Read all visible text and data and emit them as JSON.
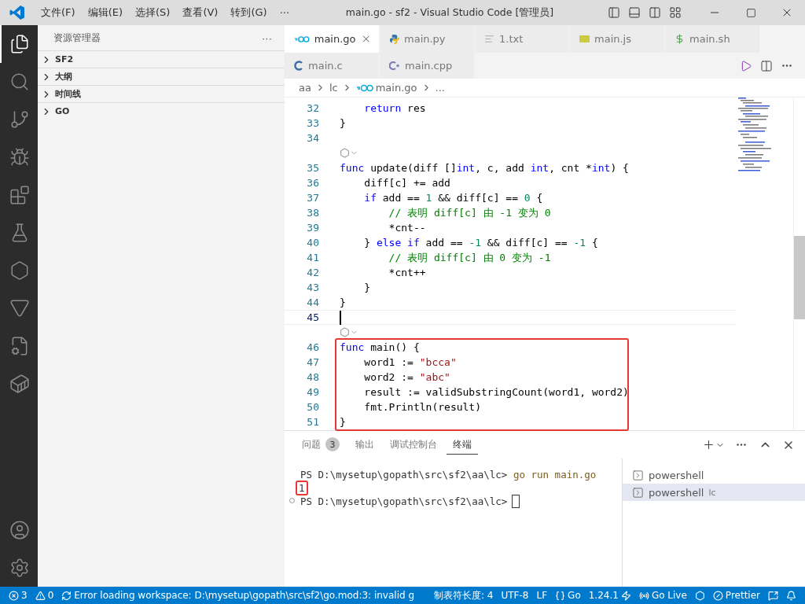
{
  "title_bar": {
    "menus": [
      "文件(F)",
      "编辑(E)",
      "选择(S)",
      "查看(V)",
      "转到(G)",
      "···"
    ],
    "title": "main.go - sf2 - Visual Studio Code [管理员]"
  },
  "activity_bar": {
    "items": [
      {
        "kind": "explorer",
        "selected": true
      },
      {
        "kind": "search",
        "selected": false
      },
      {
        "kind": "scm",
        "selected": false
      },
      {
        "kind": "debug",
        "selected": false
      },
      {
        "kind": "extensions",
        "selected": false
      },
      {
        "kind": "testing",
        "selected": false
      },
      {
        "kind": "codegeex",
        "selected": false
      },
      {
        "kind": "funnel",
        "selected": false
      },
      {
        "kind": "filecog",
        "selected": false
      },
      {
        "kind": "docker",
        "selected": false
      }
    ],
    "bottom": [
      {
        "kind": "account"
      },
      {
        "kind": "settings"
      }
    ]
  },
  "sidebar": {
    "title": "资源管理器",
    "more": "···",
    "sections": [
      {
        "label": "SF2",
        "expanded": false
      },
      {
        "label": "大纲",
        "expanded": false
      },
      {
        "label": "时间线",
        "expanded": false
      },
      {
        "label": "GO",
        "expanded": false
      }
    ]
  },
  "tabs": [
    [
      {
        "label": "main.go",
        "kind": "go",
        "selected": true
      },
      {
        "label": "main.py",
        "kind": "python",
        "selected": false
      },
      {
        "label": "1.txt",
        "kind": "txt",
        "selected": false
      },
      {
        "label": "main.js",
        "kind": "js",
        "selected": false
      },
      {
        "label": "main.sh",
        "kind": "sh",
        "selected": false
      }
    ],
    [
      {
        "label": "main.c",
        "kind": "c",
        "selected": false
      },
      {
        "label": "main.cpp",
        "kind": "cpp",
        "selected": false
      }
    ]
  ],
  "breadcrumb": [
    {
      "label": "aa",
      "kind": "folder"
    },
    {
      "label": "lc",
      "kind": "folder"
    },
    {
      "label": "main.go",
      "kind": "go"
    },
    {
      "label": "...",
      "kind": "more"
    }
  ],
  "code": [
    {
      "kind": "line",
      "number": "32",
      "tokens": [
        {
          "t": "    return",
          "color": "#0000ff"
        },
        {
          "t": " res"
        }
      ]
    },
    {
      "kind": "line",
      "number": "33",
      "tokens": [
        {
          "t": "}"
        }
      ]
    },
    {
      "kind": "line",
      "number": "34"
    },
    {
      "kind": "codelens"
    },
    {
      "kind": "line",
      "number": "35",
      "tokens": [
        {
          "t": "func",
          "color": "#0000ff"
        },
        {
          "t": " update(diff []"
        },
        {
          "t": "int",
          "color": "#0000ff"
        },
        {
          "t": ", c, add "
        },
        {
          "t": "int",
          "color": "#0000ff"
        },
        {
          "t": ", cnt *"
        },
        {
          "t": "int",
          "color": "#0000ff"
        },
        {
          "t": ") {"
        }
      ]
    },
    {
      "kind": "line",
      "number": "36",
      "tokens": [
        {
          "t": "    diff[c] += add"
        }
      ]
    },
    {
      "kind": "line",
      "number": "37",
      "tokens": [
        {
          "t": "    if",
          "color": "#0000ff"
        },
        {
          "t": " add == "
        },
        {
          "t": "1",
          "color": "#098658"
        },
        {
          "t": " && diff[c] == "
        },
        {
          "t": "0",
          "color": "#098658"
        },
        {
          "t": " {"
        }
      ]
    },
    {
      "kind": "line",
      "number": "38",
      "tokens": [
        {
          "t": "        // 表明 diff[c] 由 -1 变为 0",
          "color": "#008000"
        }
      ]
    },
    {
      "kind": "line",
      "number": "39",
      "tokens": [
        {
          "t": "        *cnt--"
        }
      ]
    },
    {
      "kind": "line",
      "number": "40",
      "tokens": [
        {
          "t": "    } "
        },
        {
          "t": "else if",
          "color": "#0000ff"
        },
        {
          "t": " add == "
        },
        {
          "t": "-1",
          "color": "#098658"
        },
        {
          "t": " && diff[c] == "
        },
        {
          "t": "-1",
          "color": "#098658"
        },
        {
          "t": " {"
        }
      ]
    },
    {
      "kind": "line",
      "number": "41",
      "tokens": [
        {
          "t": "        // 表明 diff[c] 由 0 变为 -1",
          "color": "#008000"
        }
      ]
    },
    {
      "kind": "line",
      "number": "42",
      "tokens": [
        {
          "t": "        *cnt++"
        }
      ]
    },
    {
      "kind": "line",
      "number": "43",
      "tokens": [
        {
          "t": "    }"
        }
      ]
    },
    {
      "kind": "line",
      "number": "44",
      "tokens": [
        {
          "t": "}"
        }
      ]
    },
    {
      "kind": "line",
      "number": "45",
      "current": true
    },
    {
      "kind": "codelens"
    },
    {
      "kind": "highlight",
      "lines": [
        {
          "number": "46",
          "tokens": [
            {
              "t": "func",
              "color": "#0000ff"
            },
            {
              "t": " main() {"
            }
          ]
        },
        {
          "number": "47",
          "tokens": [
            {
              "t": "    word1 := "
            },
            {
              "t": "\"bcca\"",
              "color": "#a31515"
            }
          ]
        },
        {
          "number": "48",
          "tokens": [
            {
              "t": "    word2 := "
            },
            {
              "t": "\"abc\"",
              "color": "#a31515"
            }
          ]
        },
        {
          "number": "49",
          "tokens": [
            {
              "t": "    result := validSubstringCount(word1, word2)"
            }
          ]
        },
        {
          "number": "50",
          "tokens": [
            {
              "t": "    fmt.Println(result)"
            }
          ]
        },
        {
          "number": "51",
          "tokens": [
            {
              "t": "}"
            }
          ]
        }
      ]
    }
  ],
  "panel": {
    "tabs": [
      {
        "label": "问题",
        "badge": "3",
        "selected": false
      },
      {
        "label": "输出",
        "selected": false
      },
      {
        "label": "调试控制台",
        "selected": false
      },
      {
        "label": "终端",
        "selected": true
      }
    ],
    "terminal": [
      {
        "kind": "prompt",
        "prompt": "PS D:\\mysetup\\gopath\\src\\sf2\\aa\\lc>",
        "command": "go run main.go",
        "decorated": false,
        "cursor": false
      },
      {
        "kind": "highlighted_output",
        "text": "1"
      },
      {
        "kind": "prompt",
        "prompt": "PS D:\\mysetup\\gopath\\src\\sf2\\aa\\lc>",
        "decorated": true,
        "cursor": true
      }
    ],
    "instances": [
      {
        "label": "powershell",
        "selected": false
      },
      {
        "label": "powershell",
        "detail": "lc",
        "selected": true
      }
    ]
  },
  "status_bar": {
    "left": [
      {
        "kind": "errors",
        "text": "3"
      },
      {
        "kind": "warnings",
        "text": "0"
      },
      {
        "kind": "sync",
        "text": "Error loading workspace: D:\\mysetup\\gopath\\src\\sf2\\go.mod:3: invalid g"
      }
    ],
    "right": [
      {
        "kind": "text",
        "text": "制表符长度: 4"
      },
      {
        "kind": "text",
        "text": "UTF-8"
      },
      {
        "kind": "text",
        "text": "LF"
      },
      {
        "kind": "language",
        "text": "Go"
      },
      {
        "kind": "version",
        "text": "1.24.1"
      },
      {
        "kind": "live",
        "text": "Go Live"
      },
      {
        "kind": "codegeex"
      },
      {
        "kind": "prettier",
        "text": "Prettier"
      },
      {
        "kind": "feedback"
      },
      {
        "kind": "bell"
      }
    ]
  }
}
